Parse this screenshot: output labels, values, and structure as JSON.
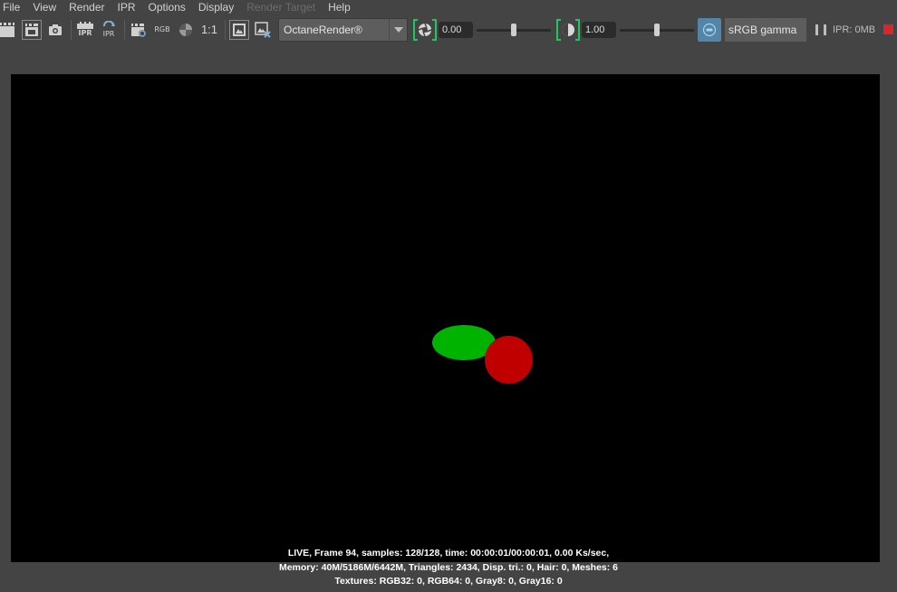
{
  "menubar": {
    "items": [
      {
        "label": "File",
        "enabled": true
      },
      {
        "label": "View",
        "enabled": true
      },
      {
        "label": "Render",
        "enabled": true
      },
      {
        "label": "IPR",
        "enabled": true
      },
      {
        "label": "Options",
        "enabled": true
      },
      {
        "label": "Display",
        "enabled": true
      },
      {
        "label": "Render Target",
        "enabled": false
      },
      {
        "label": "Help",
        "enabled": true
      }
    ]
  },
  "toolbar": {
    "icons": {
      "redo_render": "clapperboard-icon",
      "render_region": "render-region-icon",
      "snapshot": "camera-icon",
      "ipr_render": "ipr-render-icon",
      "ipr_refresh": "ipr-refresh-icon",
      "render_settings": "render-settings-icon",
      "rgb_channel": "rgb-channel-icon",
      "alpha_channel": "alpha-channel-icon",
      "keep_image": "keep-image-icon",
      "remove_image": "remove-image-icon"
    },
    "ipr_label": "IPR",
    "rgb_label": "RGB",
    "ratio_label": "1:1",
    "renderer": "OctaneRender®",
    "exposure_value": "0.00",
    "exposure_slider_fraction": 0.5,
    "gamma_value": "1.00",
    "gamma_slider_fraction": 0.5,
    "color_management_label": "sRGB gamma",
    "ipr_memory": "IPR: 0MB"
  },
  "colors": {
    "accent_green": "#22c55e",
    "ocio_blue": "#5285a6",
    "stop_red": "#d9262c",
    "sphere_green": "#00b300",
    "sphere_red": "#c00000"
  },
  "status": {
    "line1": "LIVE, Frame 94, samples: 128/128, time: 00:00:01/00:00:01, 0.00 Ks/sec,",
    "line2": "Memory: 40M/5186M/6442M, Triangles: 2434, Disp. tri.: 0, Hair: 0, Meshes: 6",
    "line3": "Textures: RGB32: 0, RGB64: 0, Gray8: 0, Gray16: 0"
  }
}
